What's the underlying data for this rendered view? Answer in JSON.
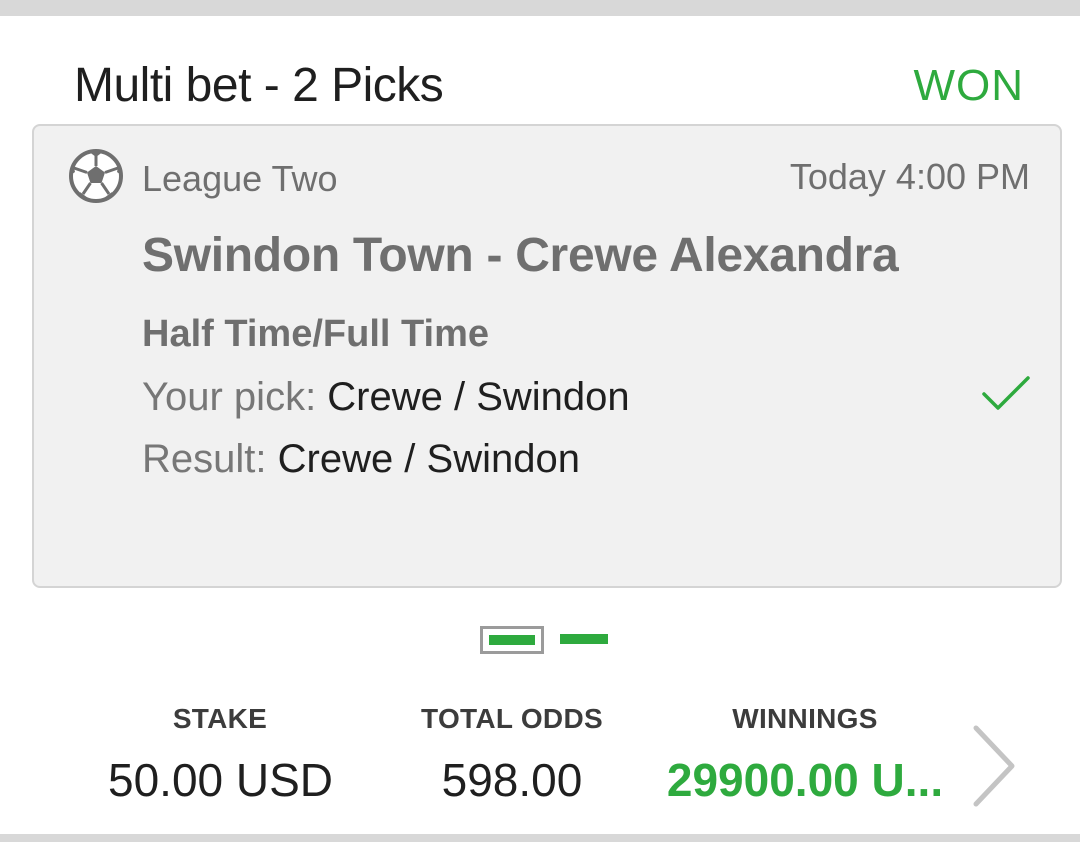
{
  "header": {
    "title": "Multi bet - 2 Picks",
    "status": "WON",
    "status_color": "#2eaa3e"
  },
  "pick": {
    "sport_icon": "soccer-ball-icon",
    "league": "League Two",
    "time": "Today 4:00 PM",
    "event": "Swindon Town - Crewe Alexandra",
    "market": "Half Time/Full Time",
    "your_pick_label": "Your pick: ",
    "your_pick_value": "Crewe / Swindon",
    "result_label": "Result: ",
    "result_value": "Crewe / Swindon",
    "outcome_icon": "checkmark-icon"
  },
  "pager": {
    "total": 2,
    "active_index": 0
  },
  "summary": {
    "stake_label": "STAKE",
    "stake_value": "50.00 USD",
    "odds_label": "TOTAL ODDS",
    "odds_value": "598.00",
    "winnings_label": "WINNINGS",
    "winnings_value": "29900.00 U..."
  },
  "colors": {
    "accent": "#2eaa3e",
    "muted_text": "#6f6f6f",
    "dark_text": "#1f1f1f",
    "panel_bg": "#f1f1f1"
  }
}
